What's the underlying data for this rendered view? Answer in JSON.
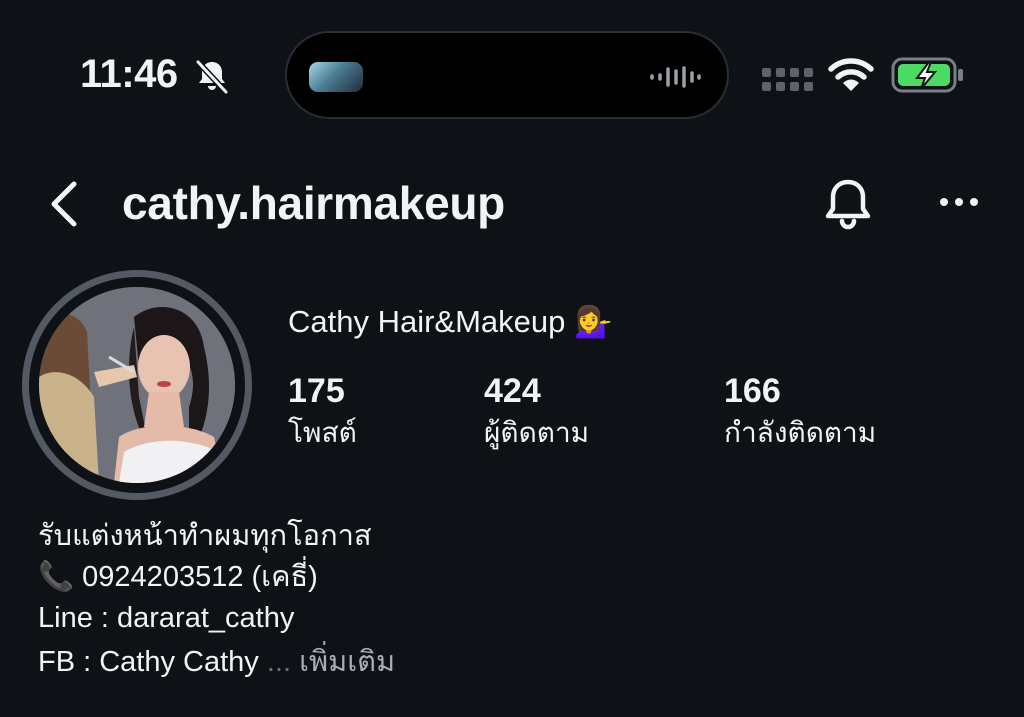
{
  "status_bar": {
    "time": "11:46",
    "icons": [
      "bell-slash-icon",
      "dynamic-island",
      "signal-icon",
      "wifi-icon",
      "battery-charging-icon"
    ]
  },
  "header": {
    "username": "cathy.hairmakeup",
    "icons": [
      "back-chevron-icon",
      "bell-icon",
      "more-icon"
    ]
  },
  "profile": {
    "display_name": "Cathy Hair&Makeup 💁‍♀️",
    "stats": [
      {
        "value": "175",
        "label": "โพสต์"
      },
      {
        "value": "424",
        "label": "ผู้ติดตาม"
      },
      {
        "value": "166",
        "label": "กำลังติดตาม"
      }
    ]
  },
  "bio": {
    "line1": "รับแต่งหน้าทำผมทุกโอกาส",
    "phone_emoji": "📞",
    "line2": "0924203512 (เคธี่)",
    "line3": "Line : dararat_cathy",
    "line4": "FB : Cathy Cathy",
    "ellipsis": "...",
    "more_label": "เพิ่มเติม"
  },
  "colors": {
    "background": "#0e1116",
    "text": "#f2f3f5",
    "muted": "#a9adb4",
    "battery_green": "#4cd964"
  }
}
